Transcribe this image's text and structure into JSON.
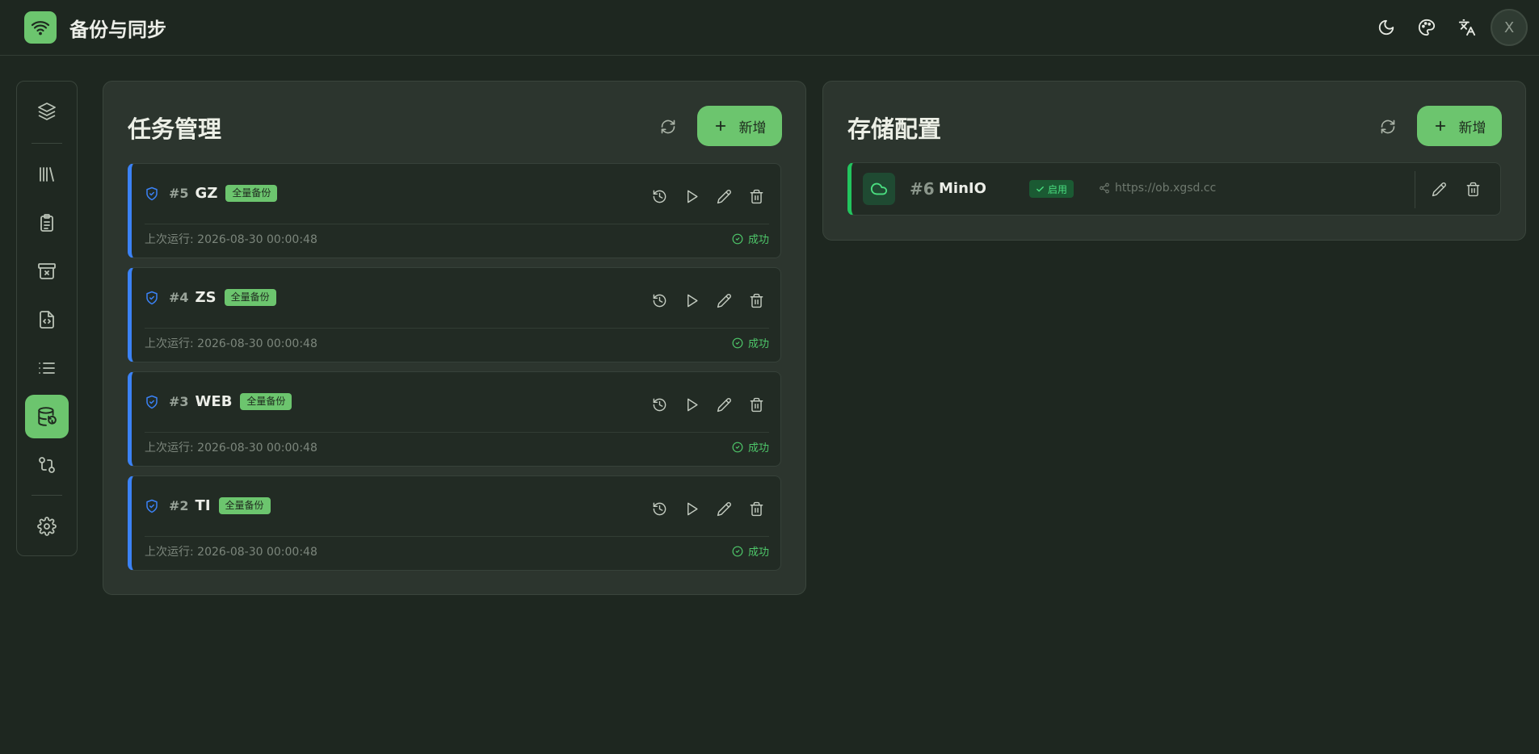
{
  "app": {
    "title": "备份与同步",
    "avatar_initial": "X"
  },
  "colors": {
    "accent": "#6cc56e",
    "task_border": "#3b82f6",
    "storage_border": "#22c55e",
    "success": "#4ec76a"
  },
  "header_icons": [
    "moon-icon",
    "palette-icon",
    "translate-icon"
  ],
  "sidebar": {
    "items": [
      {
        "icon": "layers-icon",
        "active": false
      },
      {
        "icon": "library-icon",
        "active": false
      },
      {
        "icon": "clipboard-icon",
        "active": false
      },
      {
        "icon": "archive-x-icon",
        "active": false
      },
      {
        "icon": "file-code-icon",
        "active": false
      },
      {
        "icon": "list-icon",
        "active": false
      },
      {
        "icon": "database-backup-icon",
        "active": true
      },
      {
        "icon": "git-compare-icon",
        "active": false
      },
      {
        "icon": "settings-icon",
        "active": false
      }
    ]
  },
  "tasks_panel": {
    "title": "任务管理",
    "add_label": "新增",
    "tasks": [
      {
        "num": "#5",
        "name": "GZ",
        "badge": "全量备份",
        "last_run": "上次运行: 2026-08-30 00:00:48",
        "status": "成功"
      },
      {
        "num": "#4",
        "name": "ZS",
        "badge": "全量备份",
        "last_run": "上次运行: 2026-08-30 00:00:48",
        "status": "成功"
      },
      {
        "num": "#3",
        "name": "WEB",
        "badge": "全量备份",
        "last_run": "上次运行: 2026-08-30 00:00:48",
        "status": "成功"
      },
      {
        "num": "#2",
        "name": "TI",
        "badge": "全量备份",
        "last_run": "上次运行: 2026-08-30 00:00:48",
        "status": "成功"
      }
    ]
  },
  "storage_panel": {
    "title": "存储配置",
    "add_label": "新增",
    "items": [
      {
        "num": "#6",
        "name": "MinIO",
        "badge": "启用",
        "url": "https://ob.xgsd.cc"
      }
    ]
  }
}
